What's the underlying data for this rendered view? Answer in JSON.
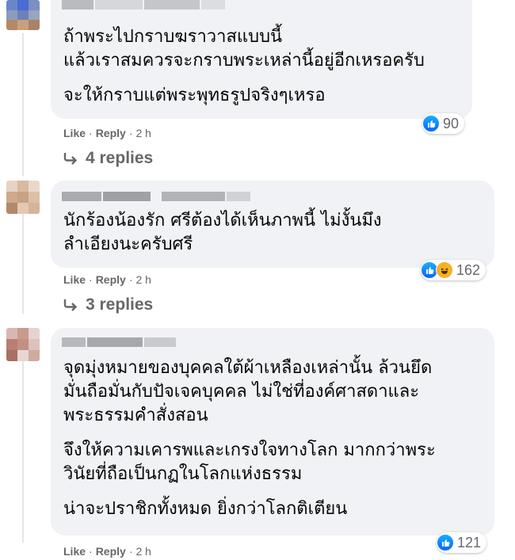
{
  "comments": [
    {
      "lines": [
        "ถ้าพระไปกราบฆราวาสแบบนี้",
        "แล้วเราสมควรจะกราบพระเหล่านี้อยู่อีกเหรอครับ",
        "จะให้กราบแต่พระพุทธรูปจริงๆเหรอ"
      ],
      "reaction_count": "90",
      "reactions": [
        "like"
      ],
      "like_label": "Like",
      "reply_label": "Reply",
      "time": "2 h",
      "replies_label": "4 replies"
    },
    {
      "lines": [
        "นักร้องน้องรัก ศรีต้องได้เห็นภาพนี้ ไม่งั้นมึง",
        "ลำเอียงนะครับศรี"
      ],
      "reaction_count": "162",
      "reactions": [
        "like",
        "haha"
      ],
      "like_label": "Like",
      "reply_label": "Reply",
      "time": "2 h",
      "replies_label": "3 replies"
    },
    {
      "lines": [
        "จุดมุ่งหมายของบุคคลใต้ผ้าเหลืองเหล่านั้น ล้วนยึด",
        "มั่นถือมั่นกับปัจเจคบุคคล ไม่ใช่ที่องค์ศาสดาและ",
        "พระธรรมคำสั่งสอน",
        "จึงให้ความเคารพและเกรงใจทางโลก มากกว่าพระ",
        "วินัยที่ถือเป็นกฏในโลกแห่งธรรม",
        "น่าจะปราชิกทั้งหมด ยิ่งกว่าโลกติเตียน"
      ],
      "reaction_count": "121",
      "reactions": [
        "like"
      ],
      "like_label": "Like",
      "reply_label": "Reply",
      "time": "2 h"
    }
  ],
  "colors": {
    "bubble": "#f0f2f5",
    "secondary_text": "#65676b",
    "like_blue": "#0866ff",
    "haha_yellow": "#f7b125"
  }
}
